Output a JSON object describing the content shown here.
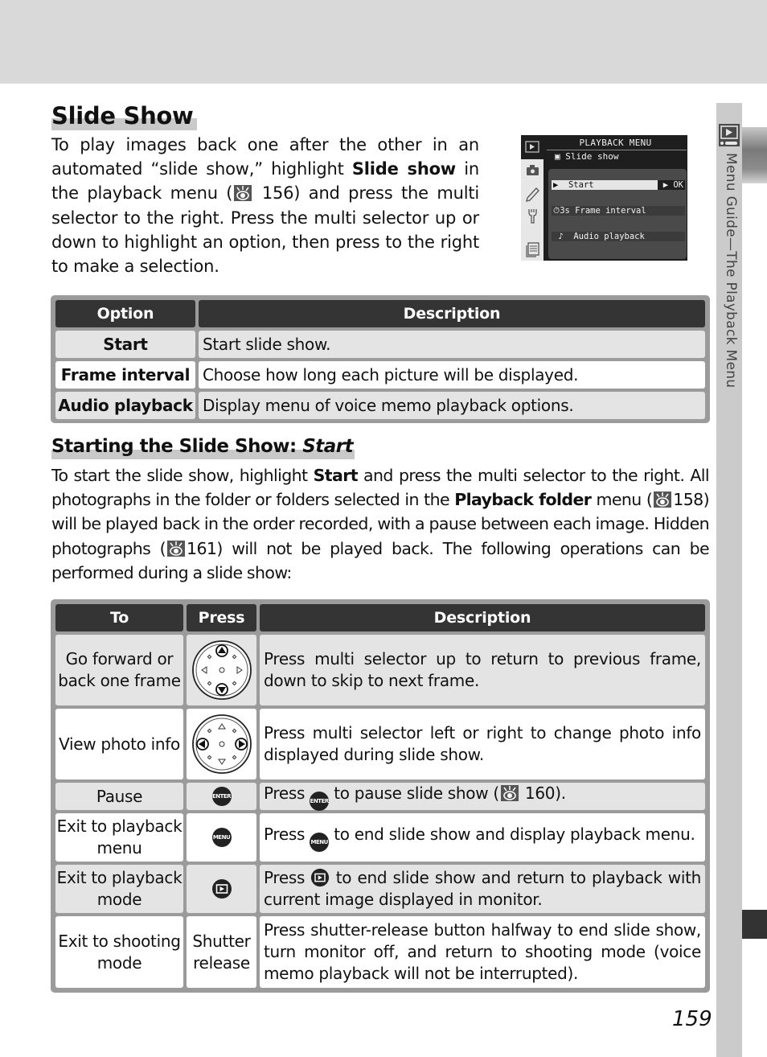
{
  "header": {
    "band_color": "#d9d9d9"
  },
  "side_tab": {
    "label": "Menu Guide—The Playback Menu",
    "icon": "playback-icon"
  },
  "page_number": "159",
  "section": {
    "title": "Slide Show",
    "intro": {
      "p1": "To play images back one after the other in an automated “slide show,” highlight ",
      "bold1": "Slide show",
      "p2": " in the playback menu (",
      "ref_icon": "reference-eye-icon",
      "ref_page": "156",
      "p3": ") and press the multi selector to the right.  Press the multi selector up or down to highlight an option, then press to the right to make a selection."
    }
  },
  "camera_screen": {
    "title": "PLAYBACK MENU",
    "subtitle": "Slide show",
    "nav_icons": [
      "playback-icon",
      "camera-icon",
      "pencil-icon",
      "wrench-icon",
      "menu-list-icon"
    ],
    "items": [
      {
        "icon": "▶",
        "label": "Start",
        "value": "▶ OK",
        "selected": true
      },
      {
        "icon": "⏱3s",
        "label": "Frame interval",
        "value": "",
        "selected": false
      },
      {
        "icon": "♪",
        "label": "Audio playback",
        "value": "",
        "selected": false
      }
    ]
  },
  "options_table": {
    "headers": [
      "Option",
      "Description"
    ],
    "rows": [
      {
        "option": "Start",
        "description": "Start slide show."
      },
      {
        "option": "Frame interval",
        "description": "Choose how long each picture will be displayed."
      },
      {
        "option": "Audio playback",
        "description": "Display menu of voice memo playback options."
      }
    ]
  },
  "subsection": {
    "title": "Starting the Slide Show: ",
    "title_italic": "Start",
    "body": {
      "t1": "To start the slide show, highlight ",
      "b1": "Start",
      "t2": " and press the multi selector to the right.  All photographs in the folder or folders selected in the ",
      "b2": "Playback folder",
      "t3": " menu (",
      "ref1": "158",
      "t4": ") will be played back in the order recorded, with a pause between each image.  Hidden photographs (",
      "ref2": "161",
      "t5": ") will not be played back.  The following operations can be performed during a slide show:"
    }
  },
  "operations_table": {
    "headers": [
      "To",
      "Press",
      "Description"
    ],
    "rows": [
      {
        "to": "Go forward or back one frame",
        "press_icon": "multi-selector-up-down-icon",
        "press_text": "",
        "description": "Press multi selector up to return to previous frame, down to skip to next frame."
      },
      {
        "to": "View photo info",
        "press_icon": "multi-selector-left-right-icon",
        "press_text": "",
        "description": "Press multi selector left or right to change photo info displayed during slide show."
      },
      {
        "to": "Pause",
        "press_icon": "enter-button-icon",
        "press_text": "ENTER",
        "description_pre": "Press ",
        "description_post": " to pause slide show (",
        "ref": "160",
        "description_end": ")."
      },
      {
        "to": "Exit to playback menu",
        "press_icon": "menu-button-icon",
        "press_text": "MENU",
        "description_pre": "Press ",
        "description_post": " to end slide show and display playback menu."
      },
      {
        "to": "Exit to playback mode",
        "press_icon": "playback-button-icon",
        "press_text": "",
        "description_pre": "Press ",
        "description_post": " to end slide show and return to playback with current image displayed in monitor."
      },
      {
        "to": "Exit to shooting mode",
        "press_icon": "",
        "press_text": "Shutter release",
        "description": "Press shutter-release button halfway to end slide show, turn monitor off, and return to shooting mode (voice memo playback will not be interrupted)."
      }
    ]
  }
}
